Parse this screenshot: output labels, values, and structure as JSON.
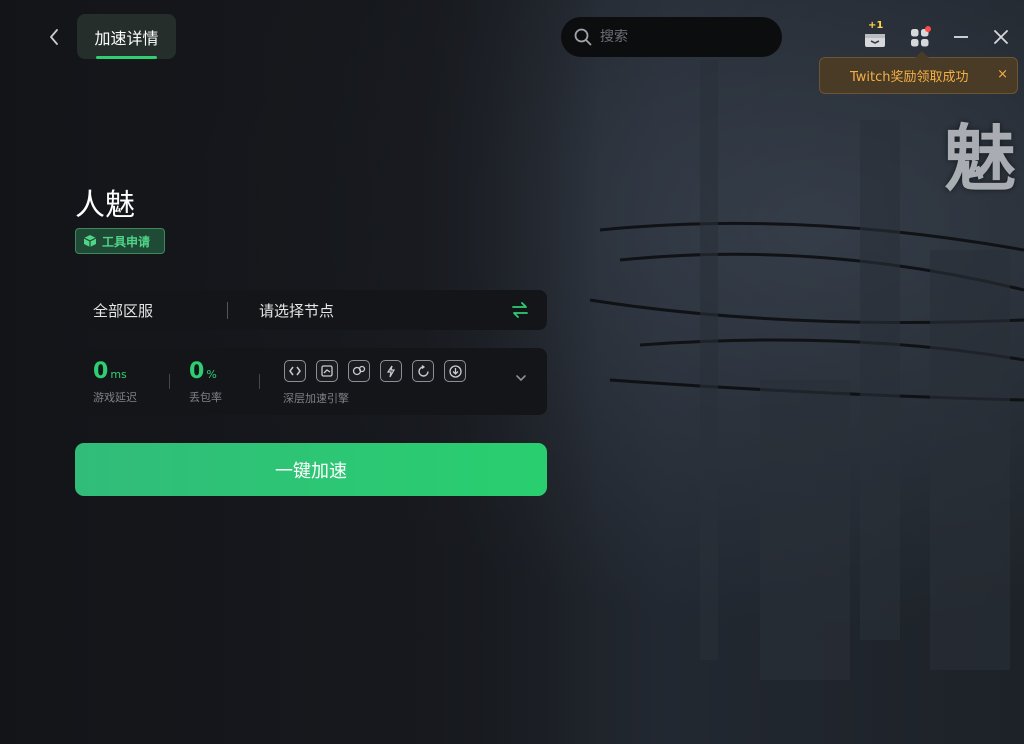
{
  "header": {
    "tab_label": "加速详情",
    "search_placeholder": "搜索",
    "gift_badge": "+1"
  },
  "toast": {
    "message": "Twitch奖励领取成功",
    "close_glyph": "×"
  },
  "background": {
    "title_glyph": "魅"
  },
  "game": {
    "title": "人魅",
    "tool_badge": "工具申请"
  },
  "node": {
    "region": "全部区服",
    "select": "请选择节点"
  },
  "stats": {
    "latency_value": "0",
    "latency_unit": "ms",
    "latency_label": "游戏延迟",
    "loss_value": "0",
    "loss_unit": "%",
    "loss_label": "丢包率",
    "engine_label": "深层加速引擎",
    "engine_icons": [
      "link-icon",
      "route-icon",
      "network-icon",
      "bolt-icon",
      "refresh-icon",
      "download-icon"
    ]
  },
  "actions": {
    "boost_label": "一键加速"
  },
  "colors": {
    "accent": "#2ecf73",
    "toast_text": "#f3b046",
    "toast_bg": "#4a3b26"
  }
}
